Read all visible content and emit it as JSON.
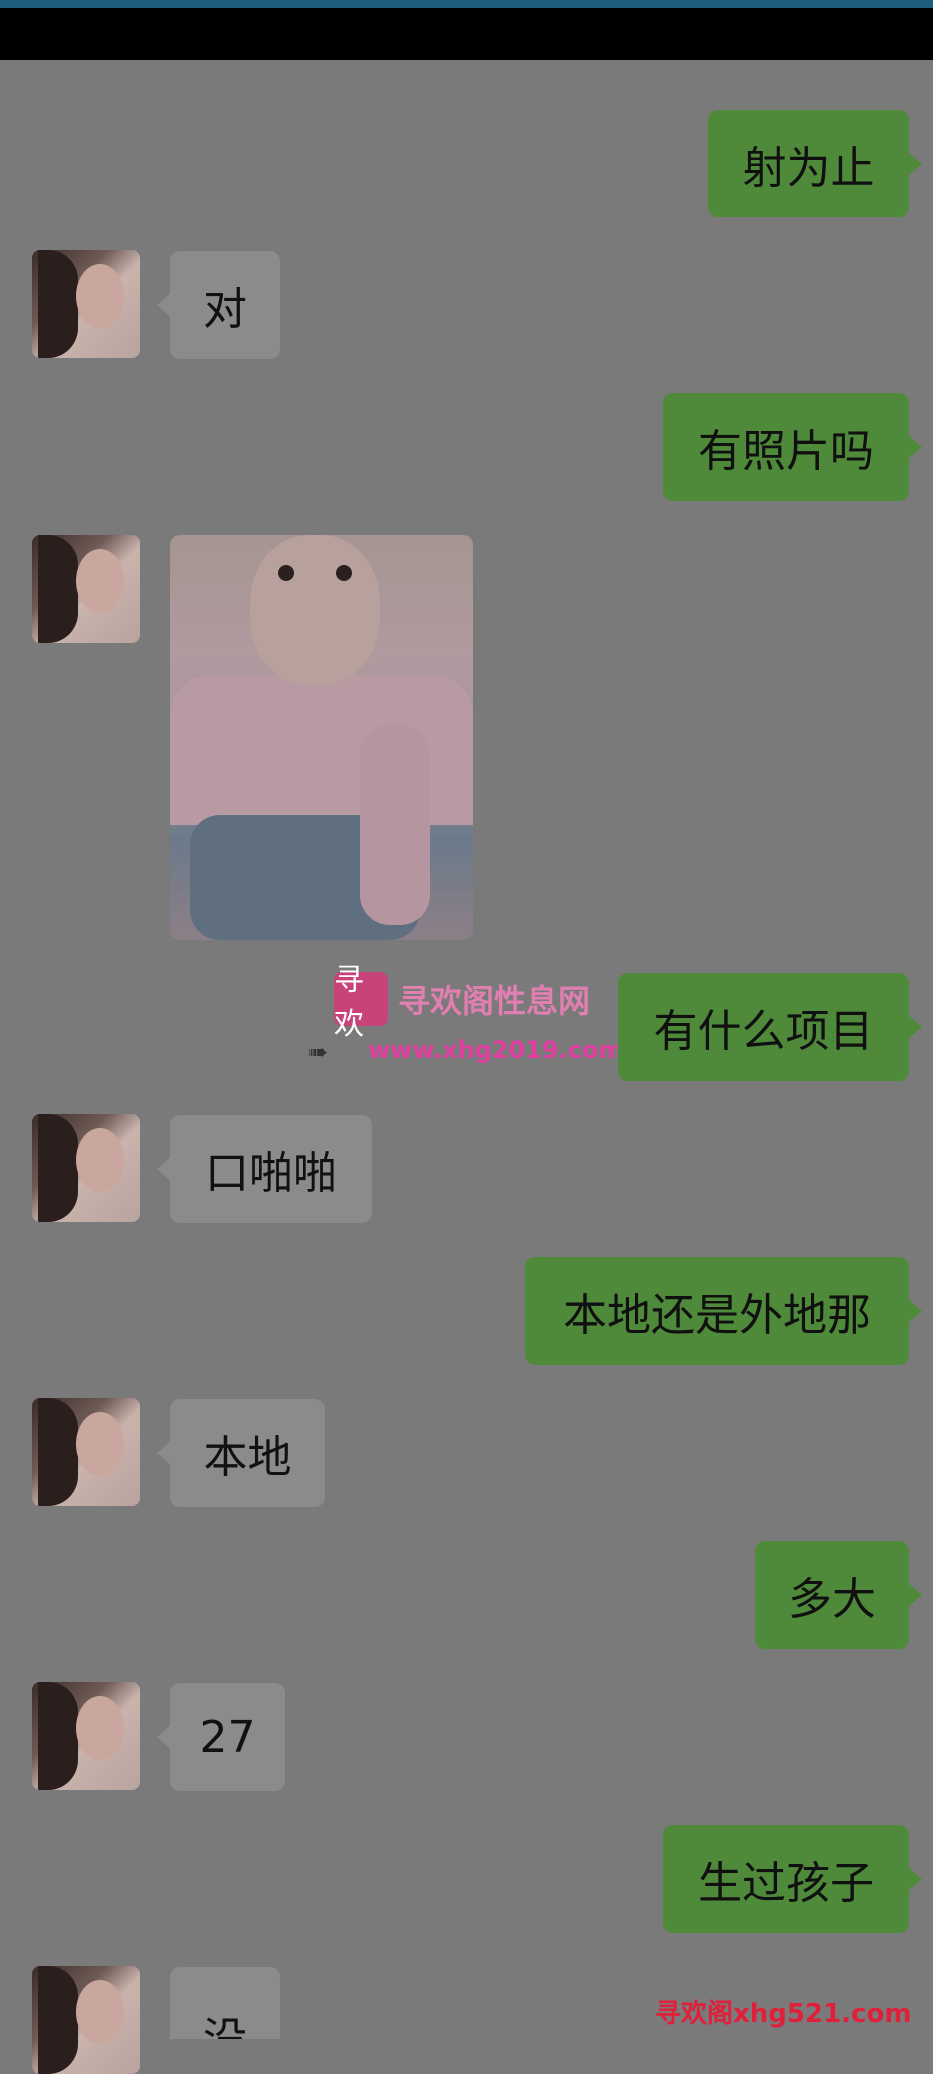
{
  "messages": [
    {
      "side": "out",
      "text": "射为止"
    },
    {
      "side": "in",
      "text": "对"
    },
    {
      "side": "out",
      "text": "有照片吗"
    },
    {
      "side": "out",
      "text": "有什么项目"
    },
    {
      "side": "in",
      "text": "口啪啪"
    },
    {
      "side": "out",
      "text": "本地还是外地那"
    },
    {
      "side": "in",
      "text": "本地"
    },
    {
      "side": "out",
      "text": "多大"
    },
    {
      "side": "in",
      "text": "27"
    },
    {
      "side": "out",
      "text": "生过孩子"
    },
    {
      "side": "in",
      "text": "没"
    }
  ],
  "watermark": {
    "logo_text": "寻欢",
    "title": "寻欢阁性息网",
    "url": "www.xhg2019.com"
  },
  "bottom_watermark": "寻欢阁xhg521.com",
  "colors": {
    "background": "#7a7a7a",
    "outgoing_bubble": "#4e8a3a",
    "incoming_bubble": "#8b8b8b",
    "top_bar": "#000000"
  }
}
